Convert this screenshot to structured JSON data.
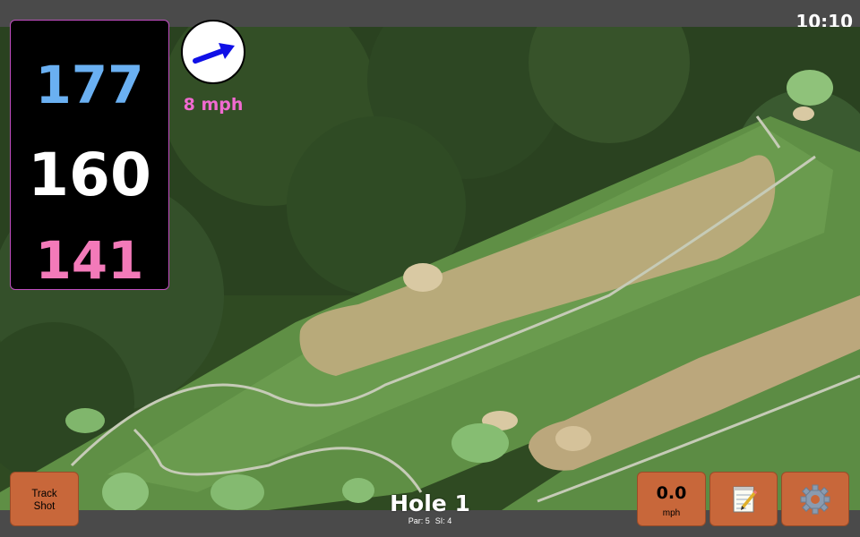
{
  "status_bar": {
    "time": "10:10"
  },
  "distances": {
    "back": "177",
    "middle": "160",
    "front": "141",
    "back_color": "#6ab0f2",
    "front_color": "#f37ab9"
  },
  "wind": {
    "speed": "8 mph",
    "icon": "wind-arrow-icon",
    "arrow_color": "#1010e6"
  },
  "hole": {
    "title": "Hole 1",
    "par": "Par: 5",
    "stroke_index": "SI: 4"
  },
  "buttons": {
    "track_shot_line1": "Track",
    "track_shot_line2": "Shot",
    "speed_value": "0.0",
    "speed_unit": "mph",
    "notes_icon": "notepad-icon",
    "settings_icon": "gear-icon"
  },
  "colors": {
    "button": "#c8673a",
    "bar": "#4a4a4a"
  }
}
